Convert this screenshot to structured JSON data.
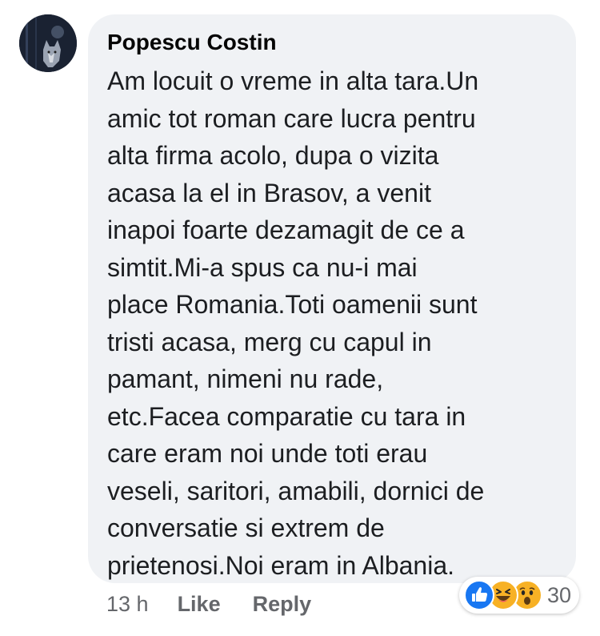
{
  "comment": {
    "author": "Popescu Costin",
    "lines": [
      "Am locuit o vreme in alta tara.Un",
      "amic tot roman care lucra pentru",
      "alta firma acolo, dupa o vizita",
      "acasa la el in Brasov, a venit",
      "inapoi foarte dezamagit de ce a",
      "simtit.Mi-a spus ca nu-i mai",
      "place Romania.Toti oamenii sunt",
      "tristi acasa, merg cu capul in",
      "pamant, nimeni nu rade,",
      "etc.Facea comparatie cu tara in",
      "care eram noi unde toti erau",
      "veseli, saritori, amabili, dornici de",
      "conversatie si extrem de",
      "prietenosi.Noi eram in Albania."
    ]
  },
  "actions": {
    "time": "13 h",
    "like_label": "Like",
    "reply_label": "Reply"
  },
  "reactions": {
    "icons": [
      "like-icon",
      "haha-icon",
      "wow-icon"
    ],
    "count": "30"
  },
  "colors": {
    "bubble": "#f0f2f5",
    "like_blue": "#1877f2",
    "emoji_yellow": "#f7b125",
    "meta_gray": "#65676b"
  }
}
